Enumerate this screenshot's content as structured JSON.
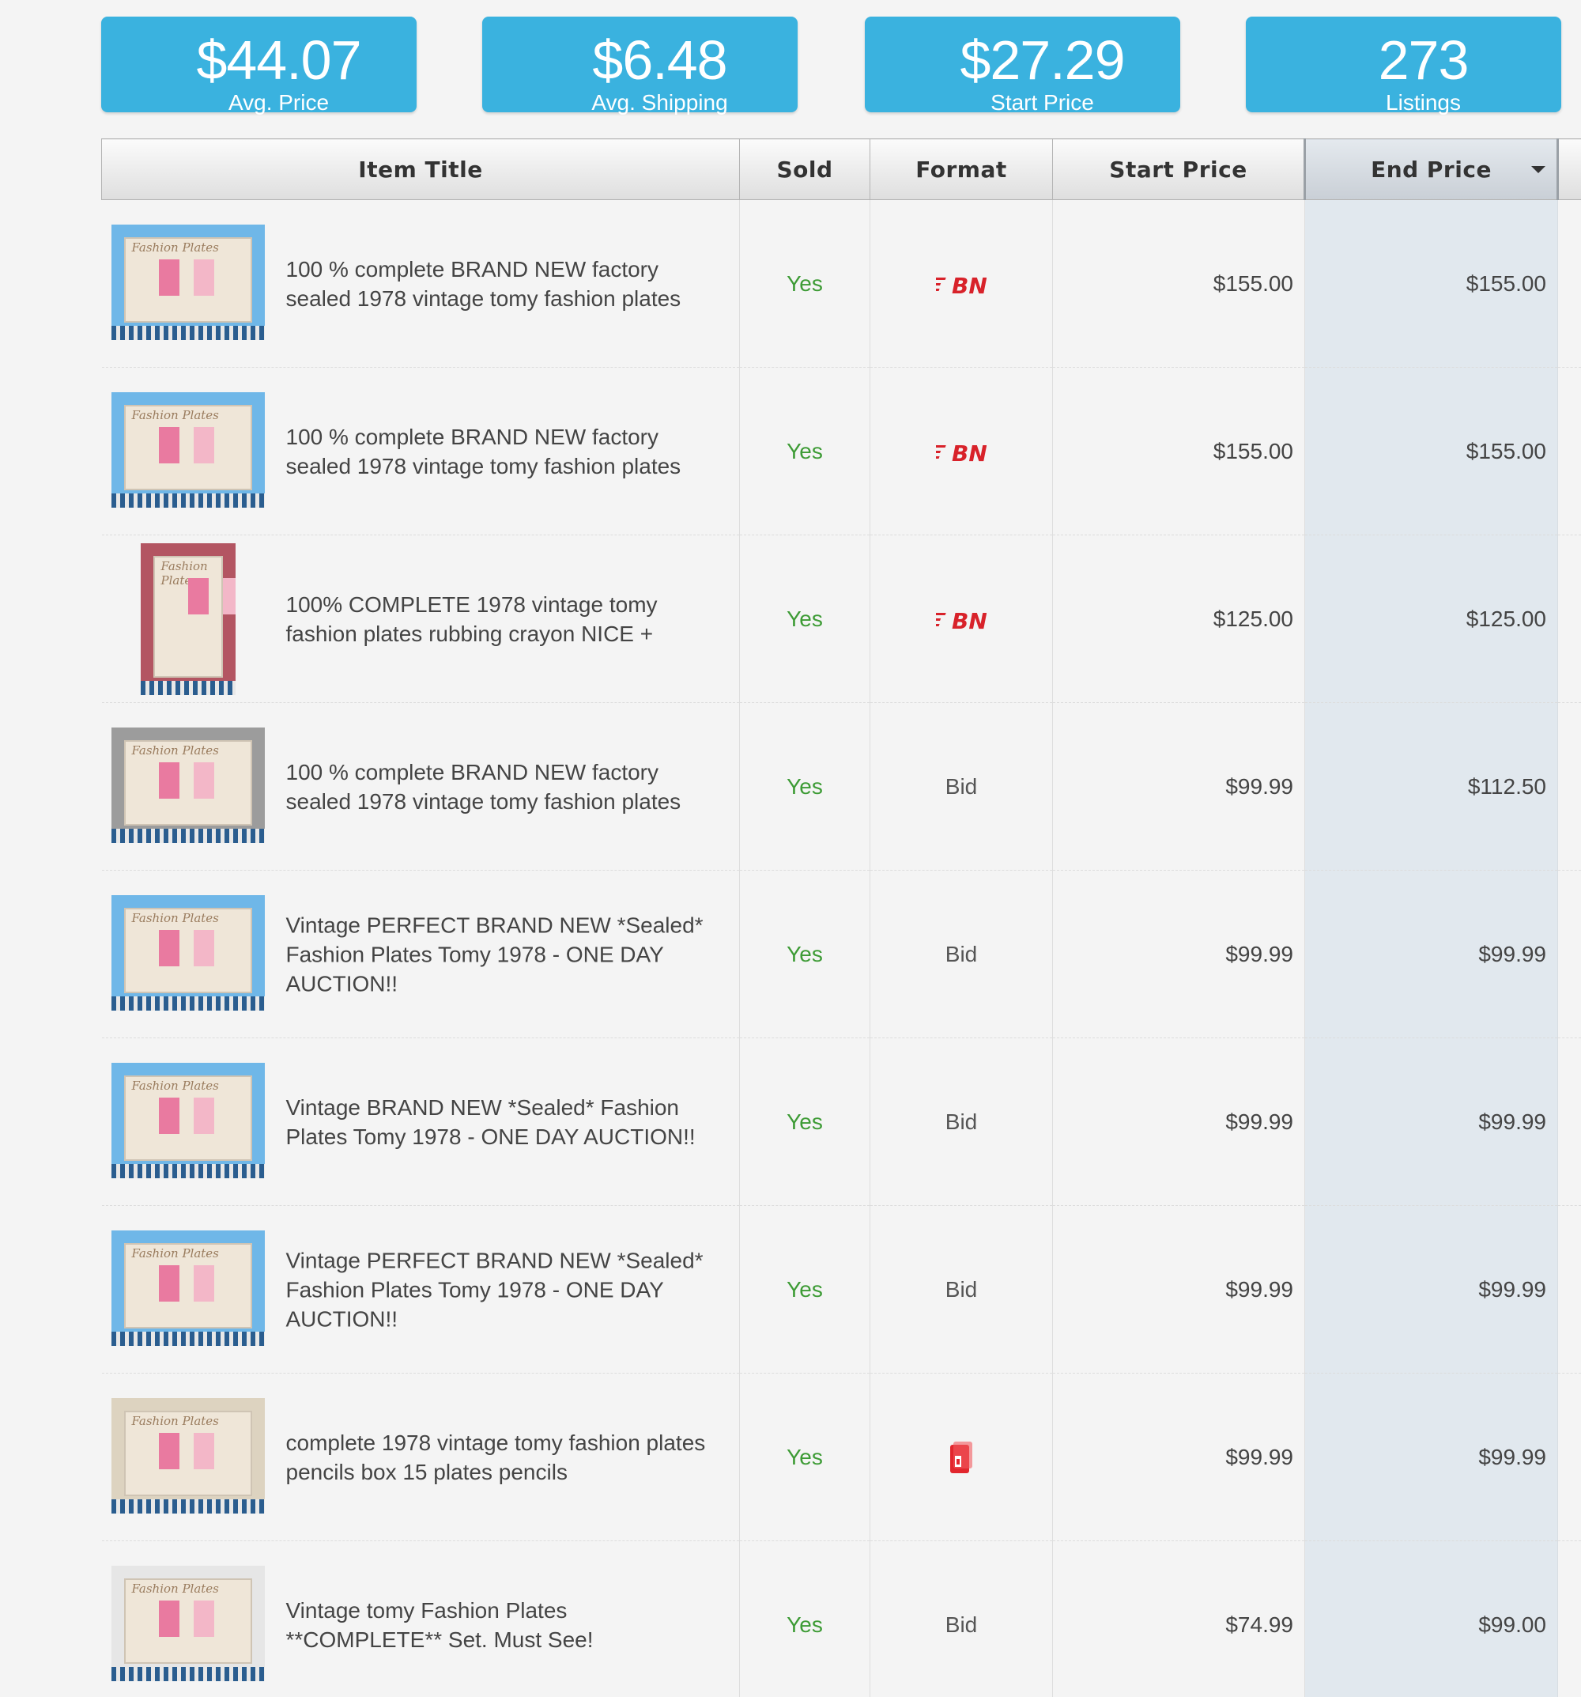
{
  "stats": [
    {
      "value": "$44.07",
      "label": "Avg. Price"
    },
    {
      "value": "$6.48",
      "label": "Avg. Shipping"
    },
    {
      "value": "$27.29",
      "label": "Start Price"
    },
    {
      "value": "273",
      "label": "Listings"
    }
  ],
  "table": {
    "headers": {
      "title": "Item Title",
      "sold": "Sold",
      "format": "Format",
      "start_price": "Start Price",
      "end_price": "End Price"
    },
    "sort": {
      "column": "end_price",
      "direction": "descending",
      "icon": "sort-down-arrow-icon"
    },
    "rows": [
      {
        "title": "100 % complete BRAND NEW factory sealed 1978 vintage tomy fashion plates",
        "sold": "Yes",
        "format": "BN",
        "format_icon": "buy-it-now-icon",
        "start_price": "$155.00",
        "end_price": "$155.00"
      },
      {
        "title": "100 % complete BRAND NEW factory sealed 1978 vintage tomy fashion plates",
        "sold": "Yes",
        "format": "BN",
        "format_icon": "buy-it-now-icon",
        "start_price": "$155.00",
        "end_price": "$155.00"
      },
      {
        "title": "100% COMPLETE 1978 vintage tomy fashion plates rubbing crayon NICE +",
        "sold": "Yes",
        "format": "BN",
        "format_icon": "buy-it-now-icon",
        "start_price": "$125.00",
        "end_price": "$125.00"
      },
      {
        "title": "100 % complete BRAND NEW factory sealed 1978 vintage tomy fashion plates",
        "sold": "Yes",
        "format": "Bid",
        "start_price": "$99.99",
        "end_price": "$112.50"
      },
      {
        "title": "Vintage PERFECT BRAND NEW *Sealed* Fashion Plates Tomy 1978 - ONE DAY AUCTION!!",
        "sold": "Yes",
        "format": "Bid",
        "start_price": "$99.99",
        "end_price": "$99.99"
      },
      {
        "title": "Vintage BRAND NEW *Sealed* Fashion Plates Tomy 1978 - ONE DAY AUCTION!!",
        "sold": "Yes",
        "format": "Bid",
        "start_price": "$99.99",
        "end_price": "$99.99"
      },
      {
        "title": "Vintage PERFECT BRAND NEW *Sealed* Fashion Plates Tomy 1978 - ONE DAY AUCTION!!",
        "sold": "Yes",
        "format": "Bid",
        "start_price": "$99.99",
        "end_price": "$99.99"
      },
      {
        "title": "complete 1978 vintage tomy fashion plates pencils box 15 plates pencils",
        "sold": "Yes",
        "format": "",
        "format_icon": "store-icon",
        "start_price": "$99.99",
        "end_price": "$99.99"
      },
      {
        "title": "Vintage tomy Fashion Plates **COMPLETE** Set. Must See!",
        "sold": "Yes",
        "format": "Bid",
        "start_price": "$74.99",
        "end_price": "$99.00"
      }
    ]
  },
  "thumbnail_caption": "Fashion Plates",
  "colors": {
    "stat_bg": "#3ab2df",
    "sold_yes": "#3d9b35",
    "bn_red": "#d8222a",
    "end_col_bg": "#e1e8ee"
  }
}
